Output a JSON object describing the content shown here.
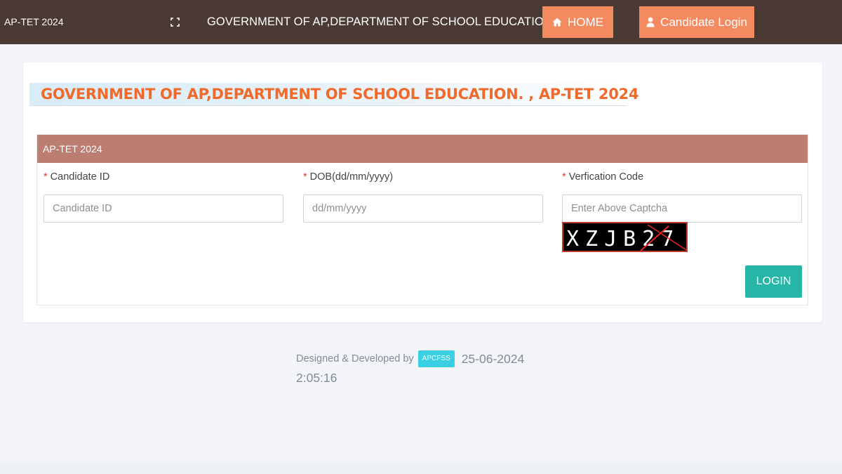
{
  "topbar": {
    "brand": "AP-TET 2024",
    "title": "GOVERNMENT OF AP,DEPARTMENT OF SCHOOL EDUCATION.",
    "home_label": "HOME",
    "candidate_login_label": "Candidate Login",
    "icons": [
      "fullscreen-icon",
      "home-icon",
      "user-icon"
    ],
    "colors": {
      "bar": "#4b3a34",
      "button": "#f48a5f"
    }
  },
  "page": {
    "heading": "GOVERNMENT OF AP,DEPARTMENT OF SCHOOL EDUCATION. , AP-TET 2024",
    "heading_color": "#f06a2c"
  },
  "form": {
    "panel_title": "AP-TET 2024",
    "required_mark": "*",
    "candidate_id": {
      "label": "Candidate ID",
      "placeholder": "Candidate ID",
      "value": ""
    },
    "dob": {
      "label": "DOB(dd/mm/yyyy)",
      "placeholder": "dd/mm/yyyy",
      "value": ""
    },
    "verification": {
      "label": "Verfication Code",
      "placeholder": "Enter Above Captcha",
      "value": ""
    },
    "captcha_text": "XZJB27",
    "login_label": "LOGIN",
    "colors": {
      "panel_header": "#bb7e70",
      "login": "#26b5a6"
    }
  },
  "footer": {
    "designed_by": "Designed & Developed by",
    "badge": "APCFSS",
    "date": "25-06-2024",
    "time": "2:05:16"
  }
}
